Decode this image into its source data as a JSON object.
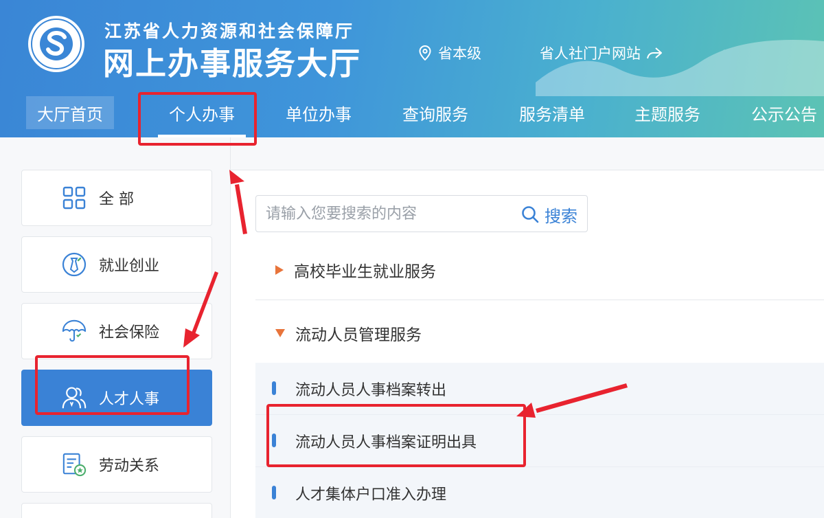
{
  "header": {
    "subtitle": "江苏省人力资源和社会保障厅",
    "title": "网上办事服务大厅",
    "location": "省本级",
    "portal_link": "省人社门户网站",
    "logo_text": "江苏省人力资源和社会保障厅"
  },
  "nav": {
    "items": [
      {
        "label": "大厅首页"
      },
      {
        "label": "个人办事"
      },
      {
        "label": "单位办事"
      },
      {
        "label": "查询服务"
      },
      {
        "label": "服务清单"
      },
      {
        "label": "主题服务"
      },
      {
        "label": "公示公告"
      }
    ],
    "active": "个人办事"
  },
  "sidebar": {
    "items": [
      {
        "label": "全 部",
        "icon": "grid-icon"
      },
      {
        "label": "就业创业",
        "icon": "tie-icon"
      },
      {
        "label": "社会保险",
        "icon": "umbrella-icon"
      },
      {
        "label": "人才人事",
        "icon": "users-icon"
      },
      {
        "label": "劳动关系",
        "icon": "document-star-icon"
      }
    ],
    "active": "人才人事"
  },
  "search": {
    "placeholder": "请输入您要搜索的内容",
    "button_label": "搜索"
  },
  "categories": [
    {
      "label": "高校毕业生就业服务",
      "expanded": false
    },
    {
      "label": "流动人员管理服务",
      "expanded": true
    }
  ],
  "services": [
    {
      "label": "流动人员人事档案转出"
    },
    {
      "label": "流动人员人事档案证明出具"
    },
    {
      "label": "人才集体户口准入办理"
    }
  ],
  "colors": {
    "primary": "#3a82d6",
    "annotation_red": "#e8232f",
    "arrow_orange": "#e8743b"
  }
}
